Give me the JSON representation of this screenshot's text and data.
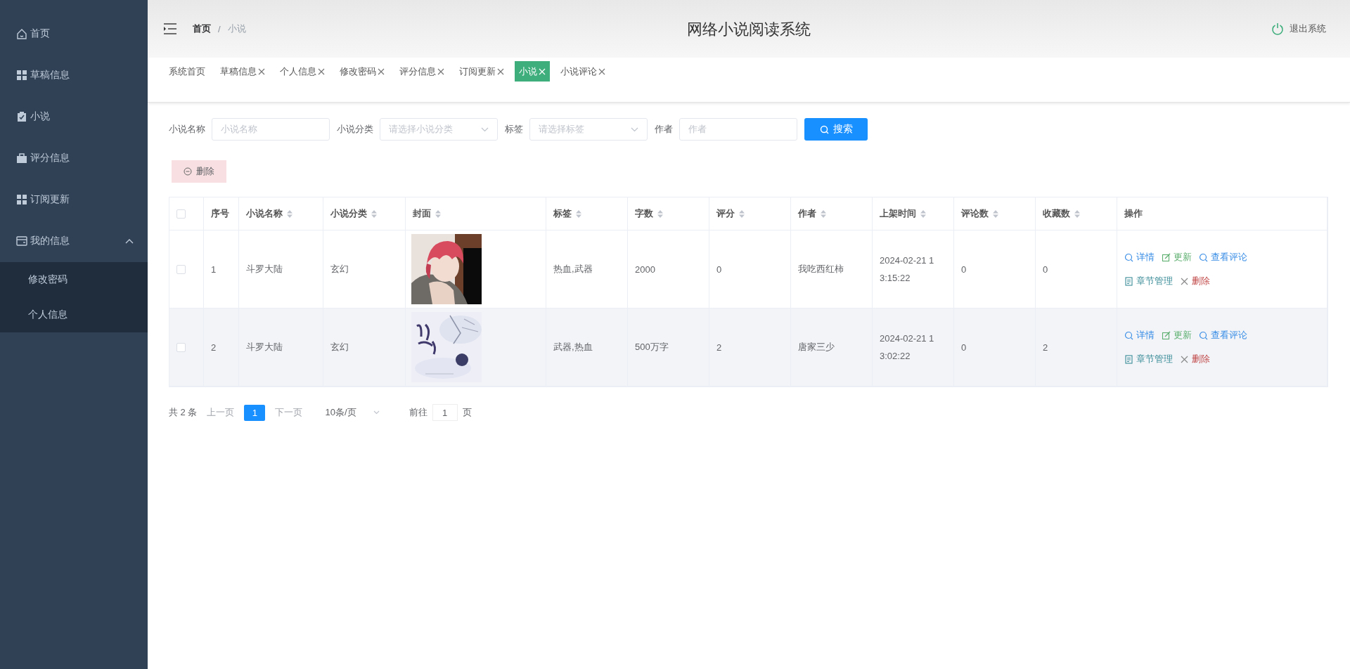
{
  "sidebar": {
    "items": [
      {
        "label": "首页"
      },
      {
        "label": "草稿信息"
      },
      {
        "label": "小说"
      },
      {
        "label": "评分信息"
      },
      {
        "label": "订阅更新"
      },
      {
        "label": "我的信息",
        "expanded": true,
        "children": [
          {
            "label": "修改密码"
          },
          {
            "label": "个人信息"
          }
        ]
      }
    ]
  },
  "header": {
    "breadcrumb": [
      "首页",
      "小说"
    ],
    "breadcrumb_separator": "/",
    "title": "网络小说阅读系统",
    "logout": "退出系统"
  },
  "tabs": [
    {
      "label": "系统首页",
      "closable": false,
      "selected": false
    },
    {
      "label": "草稿信息",
      "closable": true,
      "selected": false
    },
    {
      "label": "个人信息",
      "closable": true,
      "selected": false
    },
    {
      "label": "修改密码",
      "closable": true,
      "selected": false
    },
    {
      "label": "评分信息",
      "closable": true,
      "selected": false
    },
    {
      "label": "订阅更新",
      "closable": true,
      "selected": false
    },
    {
      "label": "小说",
      "closable": true,
      "selected": true
    },
    {
      "label": "小说评论",
      "closable": true,
      "selected": false
    }
  ],
  "filters": [
    {
      "kind": "input",
      "label": "小说名称",
      "placeholder": "小说名称"
    },
    {
      "kind": "select",
      "label": "小说分类",
      "placeholder": "请选择小说分类"
    },
    {
      "kind": "select",
      "label": "标签",
      "placeholder": "请选择标签"
    },
    {
      "kind": "input",
      "label": "作者",
      "placeholder": "作者"
    }
  ],
  "search_button": "搜索",
  "delete_button": "删除",
  "table": {
    "select_all_checked": false,
    "columns": [
      {
        "label": "序号",
        "sortable": false
      },
      {
        "label": "小说名称",
        "sortable": true
      },
      {
        "label": "小说分类",
        "sortable": true
      },
      {
        "label": "封面",
        "sortable": true
      },
      {
        "label": "标签",
        "sortable": true
      },
      {
        "label": "字数",
        "sortable": true
      },
      {
        "label": "评分",
        "sortable": true
      },
      {
        "label": "作者",
        "sortable": true
      },
      {
        "label": "上架时间",
        "sortable": true
      },
      {
        "label": "评论数",
        "sortable": true
      },
      {
        "label": "收藏数",
        "sortable": true
      },
      {
        "label": "操作",
        "sortable": false
      }
    ],
    "rows": [
      {
        "checked": false,
        "hovered": false,
        "index": "1",
        "name": "斗罗大陆",
        "category": "玄幻",
        "cover": {
          "kind": "picture"
        },
        "tags": "热血,武器",
        "words": "2000",
        "rating": "0",
        "author": "我吃西红柿",
        "listed_time": "2024-02-21 13:15:22",
        "comments": "0",
        "favorites": "0",
        "actions": [
          {
            "kind": "view",
            "label": "详情"
          },
          {
            "kind": "edit",
            "label": "更新"
          },
          {
            "kind": "comments",
            "label": "查看评论"
          },
          {
            "kind": "chapters",
            "label": "章节管理"
          },
          {
            "kind": "delete",
            "label": "删除"
          }
        ]
      },
      {
        "checked": false,
        "hovered": true,
        "index": "2",
        "name": "斗罗大陆",
        "category": "玄幻",
        "cover": {
          "kind": "picture"
        },
        "tags": "武器,热血",
        "words": "500万字",
        "rating": "2",
        "author": "唐家三少",
        "listed_time": "2024-02-21 13:02:22",
        "comments": "0",
        "favorites": "2",
        "actions": [
          {
            "kind": "view",
            "label": "详情"
          },
          {
            "kind": "edit",
            "label": "更新"
          },
          {
            "kind": "comments",
            "label": "查看评论"
          },
          {
            "kind": "chapters",
            "label": "章节管理"
          },
          {
            "kind": "delete",
            "label": "删除"
          }
        ]
      }
    ]
  },
  "pagination": {
    "total": "共 2 条",
    "prev": "上一页",
    "pages": [
      {
        "label": "1",
        "selected": true
      }
    ],
    "next": "下一页",
    "page_size": "10条/页",
    "goto_label": "前往",
    "goto_value": "1",
    "goto_suffix": "页"
  }
}
